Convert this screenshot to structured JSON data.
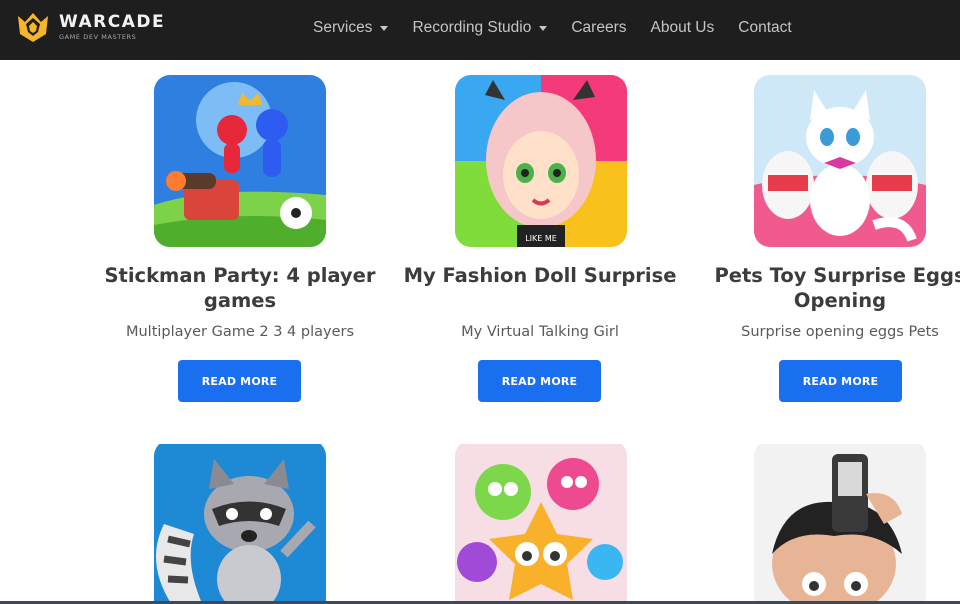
{
  "brand": {
    "name": "WARCADE",
    "tagline": "GAME DEV MASTERS"
  },
  "nav": {
    "items": [
      {
        "label": "Services",
        "dropdown": true
      },
      {
        "label": "Recording Studio",
        "dropdown": true
      },
      {
        "label": "Careers",
        "dropdown": false
      },
      {
        "label": "About Us",
        "dropdown": false
      },
      {
        "label": "Contact",
        "dropdown": false
      }
    ]
  },
  "games": [
    {
      "title": "Stickman Party: 4 player games",
      "subtitle": "Multiplayer Game 2 3 4 players",
      "button": "READ MORE",
      "icon": "stickman-party-icon"
    },
    {
      "title": "My Fashion Doll Surprise",
      "subtitle": "My Virtual Talking Girl",
      "button": "READ MORE",
      "icon": "fashion-doll-icon"
    },
    {
      "title": "Pets Toy Surprise Eggs Opening",
      "subtitle": "Surprise opening eggs Pets",
      "button": "READ MORE",
      "icon": "pets-toy-eggs-icon"
    },
    {
      "icon": "raccoon-game-icon"
    },
    {
      "icon": "jelly-candy-game-icon"
    },
    {
      "icon": "haircut-game-icon"
    }
  ],
  "colors": {
    "header_bg": "#1e1e1e",
    "accent_blue": "#1a6ff0",
    "logo_gold": "#f5b62a"
  }
}
